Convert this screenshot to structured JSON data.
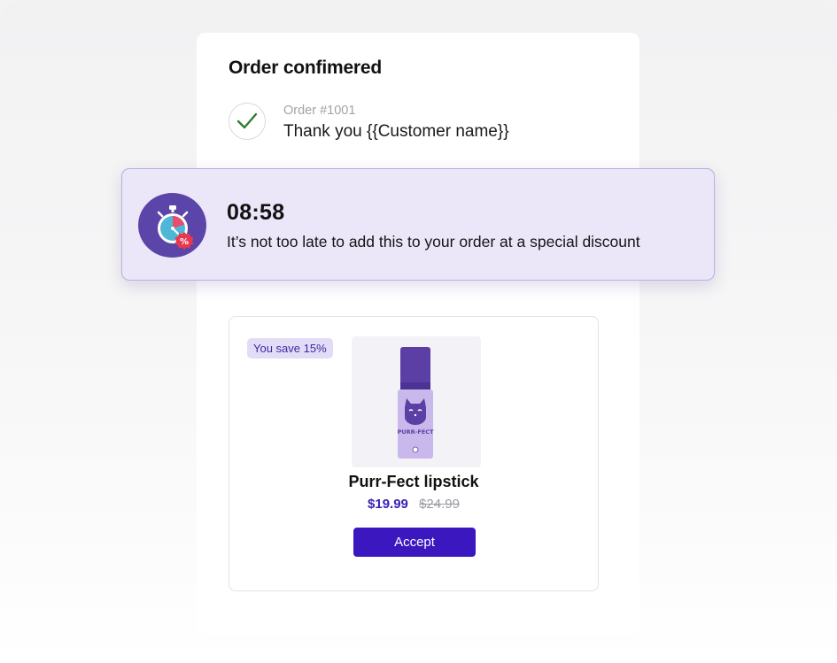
{
  "order_card": {
    "title": "Order confimered",
    "order_number": "Order #1001",
    "thank_you": "Thank you {{Customer name}}"
  },
  "timer_banner": {
    "countdown": "08:58",
    "message": "It’s not too late to add this to your order at a special discount",
    "icon": "stopwatch-discount-icon"
  },
  "offer": {
    "badge": "You save 15%",
    "product_name": "Purr-Fect lipstick",
    "product_brand_text": "PURR-FECT",
    "price_current": "$19.99",
    "price_original": "$24.99",
    "accept_label": "Accept"
  },
  "colors": {
    "accent": "#3a17bf",
    "banner_bg": "#ebe7f8",
    "badge_bg": "#e3dcf7",
    "check": "#2e7d32"
  }
}
